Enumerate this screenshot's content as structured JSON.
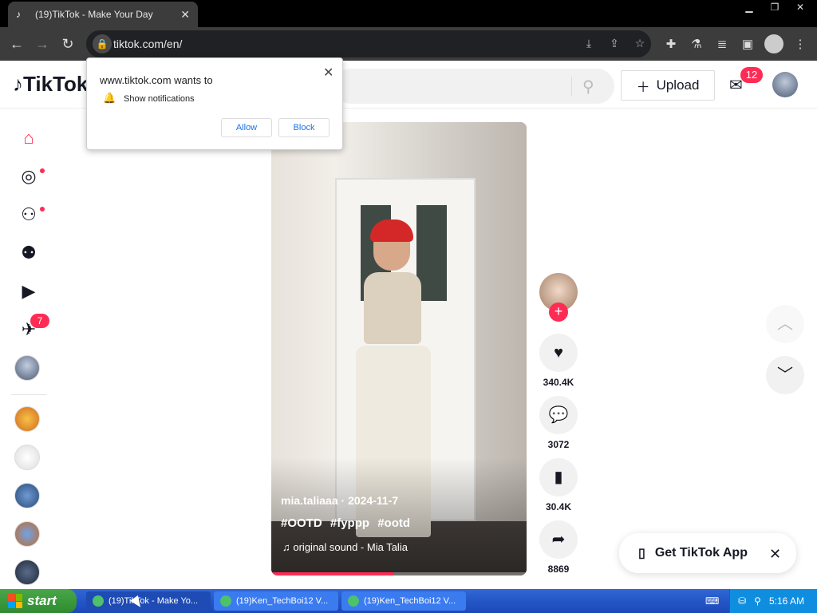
{
  "browser": {
    "tab_title": "(19)TikTok - Make Your Day",
    "url": "tiktok.com/en/"
  },
  "permission_prompt": {
    "site": "www.tiktok.com wants to",
    "permission": "Show notifications",
    "allow_label": "Allow",
    "block_label": "Block"
  },
  "header": {
    "logo_text": "TikTok",
    "upload_label": "Upload",
    "inbox_count": "12"
  },
  "sidebar": {
    "messages_badge": "7",
    "items": [
      "home-icon",
      "explore-icon",
      "following-icon",
      "friends-icon",
      "live-icon",
      "messages-icon",
      "profile-avatar"
    ]
  },
  "video": {
    "author": "mia.taliaaa",
    "date": "2024-11-7",
    "hashtags": [
      "#OOTD",
      "#fyppp",
      "#ootd"
    ],
    "sound": "original sound - Mia Talia",
    "progress": 0.48
  },
  "actions": {
    "likes": "340.4K",
    "comments": "3072",
    "saves": "30.4K",
    "shares": "8869"
  },
  "get_app": {
    "label": "Get TikTok App"
  },
  "taskbar": {
    "start_label": "start",
    "tasks": [
      "(19)TikTok - Make Yo...",
      "(19)Ken_TechBoi12 V...",
      "(19)Ken_TechBoi12 V..."
    ],
    "clock": "5:16 AM"
  },
  "colors": {
    "accent": "#fe2c55",
    "chrome_dark": "#3c3c3c",
    "taskbar_blue": "#2456c8",
    "start_green": "#3b9a3c"
  }
}
